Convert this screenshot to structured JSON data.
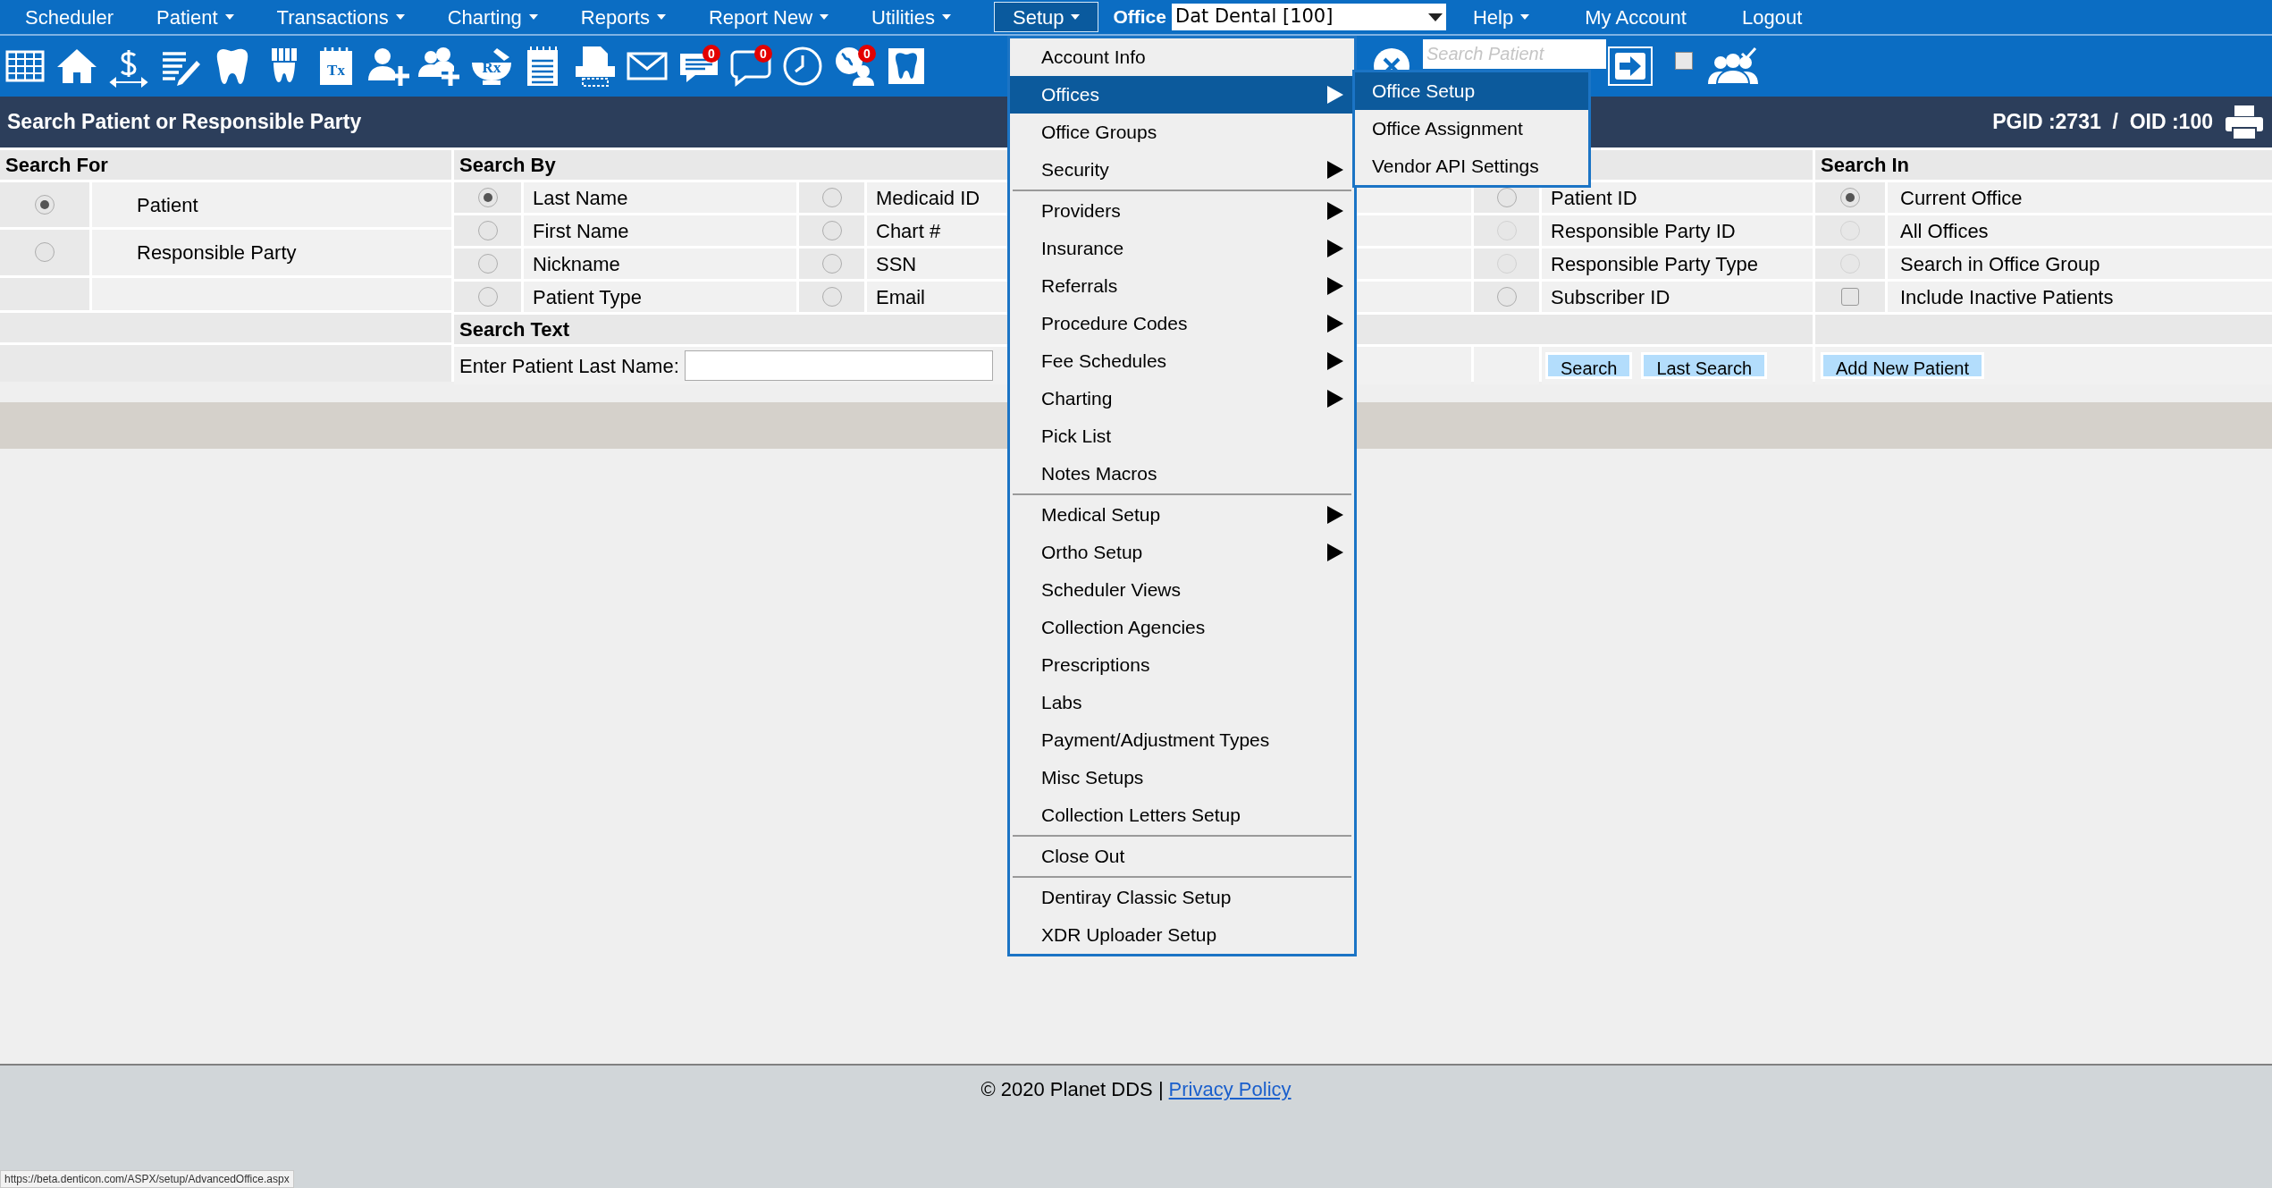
{
  "nav": {
    "items": [
      {
        "label": "Scheduler",
        "caret": false,
        "selected": false
      },
      {
        "label": "Patient",
        "caret": true,
        "selected": false
      },
      {
        "label": "Transactions",
        "caret": true,
        "selected": false
      },
      {
        "label": "Charting",
        "caret": true,
        "selected": false
      },
      {
        "label": "Reports",
        "caret": true,
        "selected": false
      },
      {
        "label": "Report New",
        "caret": true,
        "selected": false
      },
      {
        "label": "Utilities",
        "caret": true,
        "selected": false
      },
      {
        "label": "Setup",
        "caret": true,
        "selected": true
      }
    ],
    "office_label": "Office",
    "office_select": "Dat Dental [100]",
    "items_right": [
      {
        "label": "Help",
        "caret": true,
        "selected": false
      },
      {
        "label": "My Account",
        "caret": false,
        "selected": false
      },
      {
        "label": "Logout",
        "caret": false,
        "selected": false
      }
    ]
  },
  "toolbar": {
    "tools": [
      {
        "kind": "grid"
      },
      {
        "kind": "home"
      },
      {
        "kind": "dollar"
      },
      {
        "kind": "notes"
      },
      {
        "kind": "tooth"
      },
      {
        "kind": "crown"
      },
      {
        "kind": "document",
        "label": "Tx"
      },
      {
        "kind": "person-plus"
      },
      {
        "kind": "people-plus"
      },
      {
        "kind": "mortar",
        "label": "Rx"
      },
      {
        "kind": "notepad"
      },
      {
        "kind": "printer"
      },
      {
        "kind": "envelope"
      },
      {
        "kind": "chat",
        "badge": "0"
      },
      {
        "kind": "bubble",
        "badge": "0"
      },
      {
        "kind": "clock"
      },
      {
        "kind": "globe",
        "badge": "0"
      },
      {
        "kind": "tooth-frame"
      }
    ],
    "search": {
      "placeholder": "Search Patient"
    },
    "checkbox": {
      "checked": false
    }
  },
  "header": {
    "title": "Search Patient or Responsible Party",
    "ids": "PGID :2731  /  OID :100"
  },
  "search_for": {
    "heading": "Search For",
    "options": [
      {
        "label": "Patient",
        "selected": true,
        "disabled": false
      },
      {
        "label": "Responsible Party",
        "selected": false,
        "disabled": false
      }
    ]
  },
  "search_by": {
    "heading": "Search By",
    "columns": [
      [
        {
          "label": "Last Name",
          "selected": true,
          "disabled": false
        },
        {
          "label": "First Name",
          "selected": false,
          "disabled": false
        },
        {
          "label": "Nickname",
          "selected": false,
          "disabled": false
        },
        {
          "label": "Patient Type",
          "selected": false,
          "disabled": false
        }
      ],
      [
        {
          "label": "Medicaid ID",
          "selected": false,
          "disabled": false
        },
        {
          "label": "Chart #",
          "selected": false,
          "disabled": false
        },
        {
          "label": "SSN",
          "selected": false,
          "disabled": false
        },
        {
          "label": "Email",
          "selected": false,
          "disabled": false
        }
      ],
      [
        {
          "label": "Patient ID",
          "selected": false,
          "disabled": false
        },
        {
          "label": "Responsible Party ID",
          "selected": false,
          "disabled": true
        },
        {
          "label": "Responsible Party Type",
          "selected": false,
          "disabled": true
        },
        {
          "label": "Subscriber ID",
          "selected": false,
          "disabled": false
        }
      ]
    ]
  },
  "search_text": {
    "heading": "Search Text",
    "label": "Enter Patient Last Name:"
  },
  "buttons": [
    "Search",
    "Last Search"
  ],
  "search_in": {
    "heading": "Search In",
    "options": [
      {
        "label": "Current Office",
        "selected": true,
        "disabled": false
      },
      {
        "label": "All Offices",
        "selected": false,
        "disabled": true
      },
      {
        "label": "Search in Office Group",
        "selected": false,
        "disabled": true
      }
    ],
    "include_inactive": {
      "label": "Include Inactive Patients",
      "checked": false
    }
  },
  "add_button": "Add New Patient",
  "menu": {
    "groups": [
      [
        {
          "label": "Account Info",
          "submenu": false,
          "selected": false
        },
        {
          "label": "Offices",
          "submenu": true,
          "selected": true
        },
        {
          "label": "Office Groups",
          "submenu": false,
          "selected": false
        },
        {
          "label": "Security",
          "submenu": true,
          "selected": false
        }
      ],
      [
        {
          "label": "Providers",
          "submenu": true,
          "selected": false
        },
        {
          "label": "Insurance",
          "submenu": true,
          "selected": false
        },
        {
          "label": "Referrals",
          "submenu": true,
          "selected": false
        },
        {
          "label": "Procedure Codes",
          "submenu": true,
          "selected": false
        },
        {
          "label": "Fee Schedules",
          "submenu": true,
          "selected": false
        },
        {
          "label": "Charting",
          "submenu": true,
          "selected": false
        },
        {
          "label": "Pick List",
          "submenu": false,
          "selected": false
        },
        {
          "label": "Notes Macros",
          "submenu": false,
          "selected": false
        }
      ],
      [
        {
          "label": "Medical Setup",
          "submenu": true,
          "selected": false
        },
        {
          "label": "Ortho Setup",
          "submenu": true,
          "selected": false
        },
        {
          "label": "Scheduler Views",
          "submenu": false,
          "selected": false
        },
        {
          "label": "Collection Agencies",
          "submenu": false,
          "selected": false
        },
        {
          "label": "Prescriptions",
          "submenu": false,
          "selected": false
        },
        {
          "label": "Labs",
          "submenu": false,
          "selected": false
        },
        {
          "label": "Payment/Adjustment Types",
          "submenu": false,
          "selected": false
        },
        {
          "label": "Misc Setups",
          "submenu": false,
          "selected": false
        },
        {
          "label": "Collection Letters Setup",
          "submenu": false,
          "selected": false
        }
      ],
      [
        {
          "label": "Close Out",
          "submenu": false,
          "selected": false
        }
      ],
      [
        {
          "label": "Dentiray Classic Setup",
          "submenu": false,
          "selected": false
        },
        {
          "label": "XDR Uploader Setup",
          "submenu": false,
          "selected": false
        }
      ]
    ]
  },
  "submenu": {
    "items": [
      {
        "label": "Office Setup",
        "selected": true
      },
      {
        "label": "Office Assignment",
        "selected": false
      },
      {
        "label": "Vendor API Settings",
        "selected": false
      }
    ]
  },
  "footer": {
    "copyright": "© 2020 Planet DDS |",
    "link": "Privacy Policy"
  },
  "status_url": "https://beta.denticon.com/ASPX/setup/AdvancedOffice.aspx"
}
